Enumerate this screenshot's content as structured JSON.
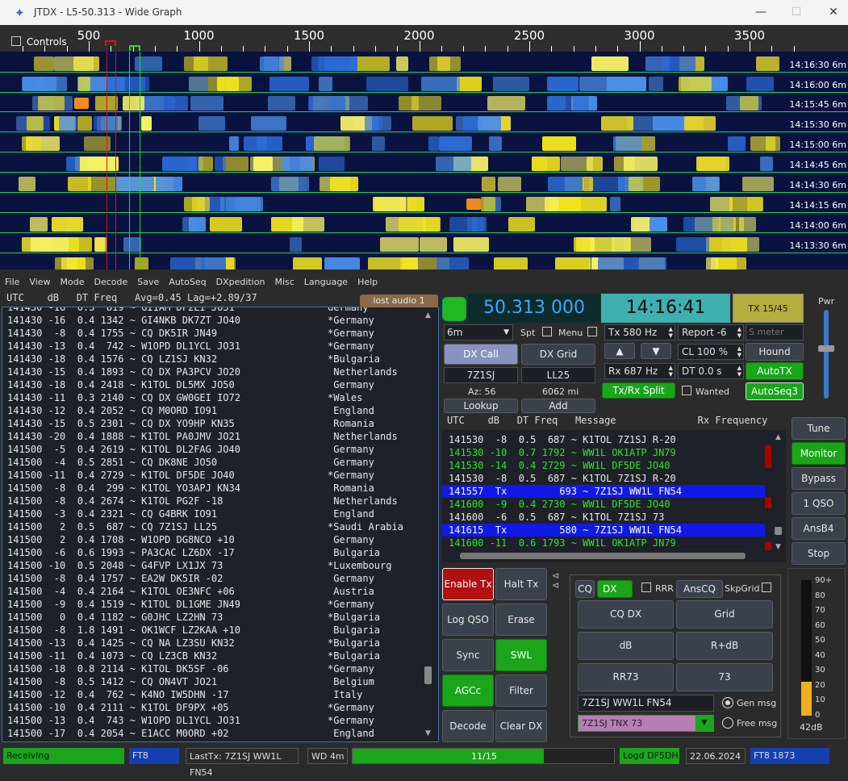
{
  "window": {
    "title": "JTDX - L5-50.313 - Wide Graph"
  },
  "waterfall": {
    "controls_label": "Controls",
    "freq_ticks": [
      "500",
      "1000",
      "1500",
      "2000",
      "2500",
      "3000",
      "3500"
    ],
    "times": [
      "14:16:30",
      "14:16:00",
      "14:15:45",
      "14:15:30",
      "14:15:00",
      "14:14:45",
      "14:14:30",
      "14:14:15",
      "14:14:00",
      "14:13:30"
    ],
    "period_suffix": "6m"
  },
  "menu": [
    "File",
    "View",
    "Mode",
    "Decode",
    "Save",
    "AutoSeq",
    "DXpedition",
    "Misc",
    "Language",
    "Help"
  ],
  "band_activity": {
    "header": "UTC    dB   DT Freq   Avg=0.45 Lag=+2.89/37",
    "rows": [
      [
        "141430 -16  0.3  819 ~ GI1AM DF2EI JO31",
        "Germany"
      ],
      [
        "141430 -16  0.4 1342 ~ GI4NKB DK7ZT JO40",
        "*Germany"
      ],
      [
        "141430  -8  0.4 1755 ~ CQ DK5IR JN49",
        "*Germany"
      ],
      [
        "141430 -13  0.4  742 ~ W1OPD DL1YCL JO31",
        "*Germany"
      ],
      [
        "141430 -18  0.4 1576 ~ CQ LZ1SJ KN32",
        "*Bulgaria"
      ],
      [
        "141430 -15  0.4 1893 ~ CQ DX PA3PCV JO20",
        " Netherlands"
      ],
      [
        "141430 -18  0.4 2418 ~ K1TOL DL5MX JO50",
        " Germany"
      ],
      [
        "141430 -11  0.3 2140 ~ CQ DX GW0GEI IO72",
        "*Wales"
      ],
      [
        "141430 -12  0.4 2052 ~ CQ M0ORD IO91",
        " England"
      ],
      [
        "141430 -15  0.5 2301 ~ CQ DX YO9HP KN35",
        " Romania"
      ],
      [
        "141430 -20  0.4 1888 ~ K1TOL PA0JMV JO21",
        " Netherlands"
      ],
      [
        "141500  -5  0.4 2619 ~ K1TOL DL2FAG JO40",
        " Germany"
      ],
      [
        "141500  -4  0.5 2851 ~ CQ DK8NE JO50",
        " Germany"
      ],
      [
        "141500 -11  0.4 2729 ~ K1TOL DF5DE JO40",
        "*Germany"
      ],
      [
        "141500  -8  0.4  299 ~ K1TOL YO3APJ KN34",
        " Romania"
      ],
      [
        "141500  -8  0.4 2674 ~ K1TOL PG2F -18",
        " Netherlands"
      ],
      [
        "141500  -3  0.4 2321 ~ CQ G4BRK IO91",
        " England"
      ],
      [
        "141500   2  0.5  687 ~ CQ 7Z1SJ LL25",
        "*Saudi Arabia"
      ],
      [
        "141500   2  0.4 1708 ~ W1OPD DG8NCO +10",
        " Germany"
      ],
      [
        "141500  -6  0.6 1993 ~ PA3CAC LZ6DX -17",
        " Bulgaria"
      ],
      [
        "141500 -10  0.5 2048 ~ G4FVP LX1JX 73",
        "*Luxembourg"
      ],
      [
        "141500  -8  0.4 1757 ~ EA2W DK5IR -02",
        " Germany"
      ],
      [
        "141500  -4  0.4 2164 ~ K1TOL OE3NFC +06",
        " Austria"
      ],
      [
        "141500  -9  0.4 1519 ~ K1TOL DL1GME JN49",
        "*Germany"
      ],
      [
        "141500   0  0.4 1182 ~ G0JHC LZ2HN 73",
        "*Bulgaria"
      ],
      [
        "141500  -8  1.8 1491 ~ OK1WCF LZ2KAA +10",
        " Bulgaria"
      ],
      [
        "141500 -13  0.4 1425 ~ CQ NA LZ3SU KN32",
        "*Bulgaria"
      ],
      [
        "141500 -11  0.4 1073 ~ CQ LZ3CB KN32",
        "*Bulgaria"
      ],
      [
        "141500 -18  0.8 2114 ~ K1TOL DK5SF -06",
        "*Germany"
      ],
      [
        "141500  -8  0.5 1412 ~ CQ ON4VT JO21",
        " Belgium"
      ],
      [
        "141500 -12  0.4  762 ~ K4NO IW5DHN -17",
        " Italy"
      ],
      [
        "141500 -10  0.4 2111 ~ K1TOL DF9PX +05",
        "*Germany"
      ],
      [
        "141500 -13  0.4  743 ~ W1OPD DL1YCL JO31",
        "*Germany"
      ],
      [
        "141500 -17  0.4 2054 ~ E1ACC M0ORD +02",
        " England"
      ]
    ]
  },
  "controls": {
    "lost_audio": "lost audio 1",
    "frequency": "50.313 000",
    "clock": "14:16:41",
    "tx_period": "TX 15/45",
    "pwr_label": "Pwr",
    "band": "6m",
    "spt": "Spt",
    "menu": "Menu",
    "tx_freq": "Tx  580  Hz",
    "report": "Report -6",
    "s_meter_placeholder": "S meter",
    "dx_call_btn": "DX Call",
    "dx_grid_btn": "DX Grid",
    "cl": "CL  100 %",
    "hound": "Hound",
    "dx_call": "7Z1SJ",
    "dx_grid": "LL25",
    "rx_freq": "Rx  687  Hz",
    "dt": "DT 0.0 s",
    "autotx": "AutoTX",
    "az": "Az: 56",
    "dist": "6062 mi",
    "txrx_split": "Tx/Rx Split",
    "wanted": "Wanted",
    "autoseq": "AutoSeq3",
    "lookup": "Lookup",
    "add": "Add"
  },
  "rx_freq": {
    "header": "UTC    dB   DT Freq   Message              Rx Frequency",
    "rows": [
      {
        "text": "141530  -8  0.5  687 ~ K1TOL 7Z1SJ R-20",
        "style": "white"
      },
      {
        "text": "141530 -10  0.7 1792 ~ WW1L OK1ATP JN79",
        "style": "green"
      },
      {
        "text": "141530 -14  0.4 2729 ~ WW1L DF5DE JO40",
        "style": "green"
      },
      {
        "text": "141530  -8  0.5  687 ~ K1TOL 7Z1SJ R-20",
        "style": "white"
      },
      {
        "text": "141557  Tx         693 ~ 7Z1SJ WW1L FN54",
        "style": "tx"
      },
      {
        "text": "141600  -9  0.4 2730 ~ WW1L DF5DE JO40",
        "style": "green"
      },
      {
        "text": "141600  -6  0.5  687 ~ K1TOL 7Z1SJ 73",
        "style": "white"
      },
      {
        "text": "141615  Tx         580 ~ 7Z1SJ WW1L FN54",
        "style": "tx"
      },
      {
        "text": "141600 -11  0.6 1793 ~ WW1L OK1ATP JN79",
        "style": "green"
      }
    ]
  },
  "side_buttons": [
    "Tune",
    "Monitor",
    "Bypass",
    "1 QSO",
    "AnsB4",
    "Stop"
  ],
  "tx_buttons": {
    "enable_tx": "Enable Tx",
    "halt_tx": "Halt Tx",
    "log_qso": "Log QSO",
    "erase": "Erase",
    "sync": "Sync",
    "swl_mode": "SWL mode",
    "agcc": "AGCc",
    "filter": "Filter",
    "decode": "Decode",
    "clear_dx": "Clear DX"
  },
  "msg_panel": {
    "cq": "CQ",
    "dx": "DX",
    "rrr": "RRR",
    "anscq": "AnsCQ",
    "skpgrid": "SkpGrid",
    "cq_dx": "CQ DX",
    "grid": "Grid",
    "db": "dB",
    "r_db": "R+dB",
    "rr73": "RR73",
    "s73": "73",
    "gen_field": "7Z1SJ WW1L FN54",
    "free_field": "7Z1SJ TNX 73",
    "gen_msg": "Gen msg",
    "free_msg": "Free msg"
  },
  "meter": {
    "labels": [
      "90+",
      "80",
      "70",
      "60",
      "50",
      "40",
      "30",
      "20",
      "10",
      "0"
    ],
    "reading": "42dB",
    "level_fraction": 0.42
  },
  "status": {
    "receiving": "Receiving",
    "mode": "FT8",
    "last_tx": "LastTx: 7Z1SJ WW1L FN54",
    "wd": "WD 4m",
    "progress": "11/15",
    "progress_fraction": 0.73,
    "logd": "Logd DF5DH",
    "date": "22.06.2024",
    "mode_count": "FT8  1873"
  }
}
